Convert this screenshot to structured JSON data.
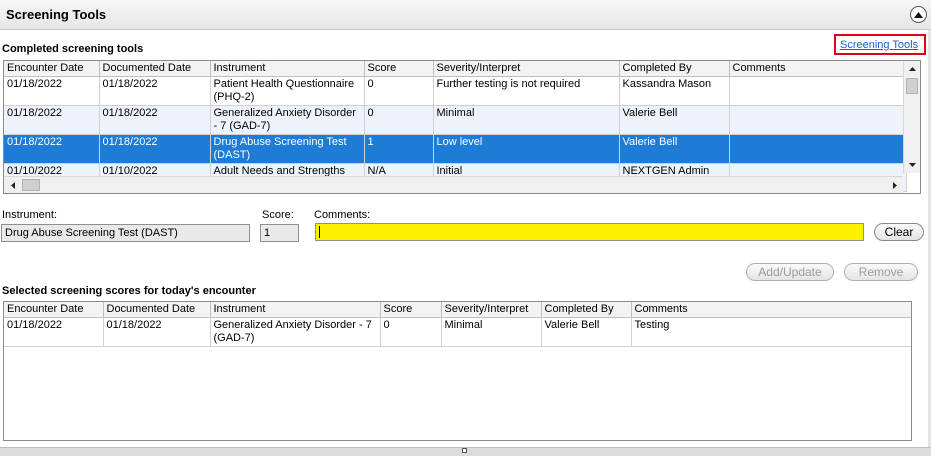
{
  "panel": {
    "title": "Screening Tools"
  },
  "completed": {
    "label": "Completed screening tools",
    "link": "Screening Tools",
    "columns": [
      "Encounter Date",
      "Documented Date",
      "Instrument",
      "Score",
      "Severity/Interpret",
      "Completed By",
      "Comments"
    ],
    "rows": [
      {
        "enc": "01/18/2022",
        "doc": "01/18/2022",
        "inst": "Patient Health Questionnaire (PHQ-2)",
        "score": "0",
        "sev": "Further testing is not required",
        "by": "Kassandra Mason",
        "comments": ""
      },
      {
        "enc": "01/18/2022",
        "doc": "01/18/2022",
        "inst": "Generalized Anxiety Disorder - 7 (GAD-7)",
        "score": "0",
        "sev": "Minimal",
        "by": "Valerie Bell",
        "comments": ""
      },
      {
        "enc": "01/18/2022",
        "doc": "01/18/2022",
        "inst": "Drug Abuse Screening Test (DAST)",
        "score": "1",
        "sev": "Low level",
        "by": "Valerie Bell",
        "comments": ""
      },
      {
        "enc": "01/10/2022",
        "doc": "01/10/2022",
        "inst": "Adult Needs and Strengths",
        "score": "N/A",
        "sev": "Initial",
        "by": "NEXTGEN Admin",
        "comments": ""
      }
    ]
  },
  "form": {
    "instrument_label": "Instrument:",
    "instrument_value": "Drug Abuse Screening Test (DAST)",
    "score_label": "Score:",
    "score_value": "1",
    "comments_label": "Comments:",
    "comments_value": "",
    "clear_button": "Clear",
    "add_button": "Add/Update",
    "remove_button": "Remove"
  },
  "selected": {
    "label": "Selected screening scores for today's encounter",
    "columns": [
      "Encounter Date",
      "Documented Date",
      "Instrument",
      "Score",
      "Severity/Interpret",
      "Completed By",
      "Comments"
    ],
    "rows": [
      {
        "enc": "01/18/2022",
        "doc": "01/18/2022",
        "inst": "Generalized Anxiety Disorder - 7 (GAD-7)",
        "score": "0",
        "sev": "Minimal",
        "by": "Valerie Bell",
        "comments": "Testing"
      }
    ]
  },
  "colors": {
    "selected_row": "#1e7bd6",
    "alt_row": "#eef3fb",
    "comments_highlight": "#ffef00",
    "link": "#1a5fd0",
    "link_border": "#e0001b"
  },
  "icons": {
    "collapse": "chevron-up-icon",
    "scroll_up": "triangle-up-icon",
    "scroll_down": "triangle-down-icon",
    "scroll_left": "triangle-left-icon",
    "scroll_right": "triangle-right-icon"
  }
}
